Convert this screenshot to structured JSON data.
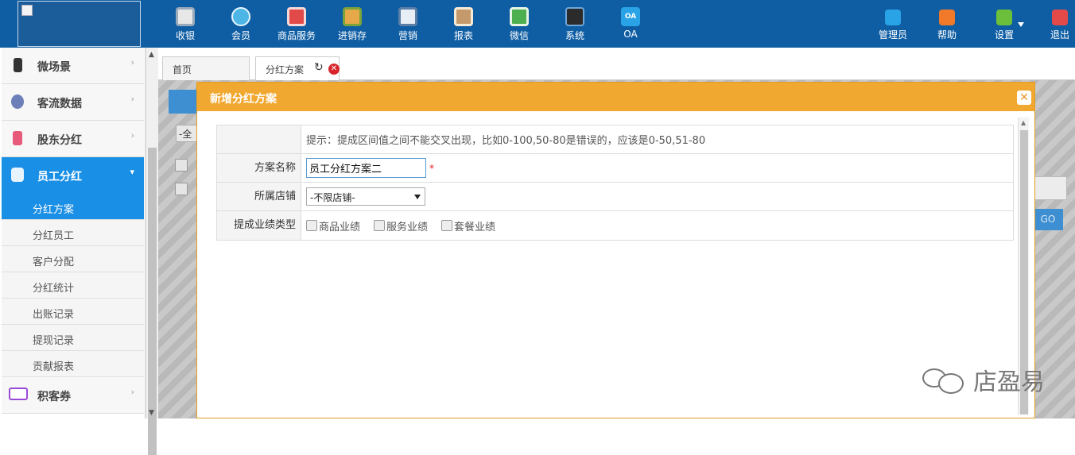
{
  "topnav": {
    "items": [
      {
        "label": "收银",
        "icon": "cash-register-icon",
        "color": "#e7e7e7"
      },
      {
        "label": "会员",
        "icon": "member-icon",
        "color": "#4db6e6"
      },
      {
        "label": "商品服务",
        "icon": "product-service-icon",
        "color": "#e24a4a"
      },
      {
        "label": "进销存",
        "icon": "inventory-icon",
        "color": "#e6a94a"
      },
      {
        "label": "营销",
        "icon": "megaphone-icon",
        "color": "#e8eef5"
      },
      {
        "label": "报表",
        "icon": "report-icon",
        "color": "#c49a6c"
      },
      {
        "label": "微信",
        "icon": "wechat-icon",
        "color": "#4caf50"
      },
      {
        "label": "系统",
        "icon": "monitor-icon",
        "color": "#2b2b2b"
      },
      {
        "label": "OA",
        "icon": "oa-icon",
        "color": "#29a3e6"
      }
    ],
    "right_items": [
      {
        "label": "管理员",
        "icon": "admin-icon",
        "color": "#29a3e6"
      },
      {
        "label": "帮助",
        "icon": "help-icon",
        "color": "#f07a2a"
      },
      {
        "label": "设置",
        "icon": "settings-gear-icon",
        "color": "#6cbf3a"
      },
      {
        "label": "退出",
        "icon": "logout-icon",
        "color": "#e24a4a"
      }
    ]
  },
  "sidebar": {
    "groups": [
      {
        "label": "微场景",
        "icon": "phone-icon",
        "color": "#333333"
      },
      {
        "label": "客流数据",
        "icon": "globe-icon",
        "color": "#6c7fb8"
      },
      {
        "label": "股东分红",
        "icon": "document-icon",
        "color": "#e85a7a"
      },
      {
        "label": "员工分红",
        "icon": "employee-icon",
        "color": "#ffffff"
      },
      {
        "label": "积客券",
        "icon": "coupon-icon",
        "color": "#9a4bd6"
      }
    ],
    "subitems": [
      "分红方案",
      "分红员工",
      "客户分配",
      "分红统计",
      "出账记录",
      "提现记录",
      "贡献报表"
    ]
  },
  "tabs": {
    "home": "首页",
    "current": "分红方案"
  },
  "background": {
    "select_text": "-全",
    "go_label": "GO"
  },
  "dialog": {
    "title": "新增分红方案",
    "hint": "提示：提成区间值之间不能交叉出现，比如0-100,50-80是错误的，应该是0-50,51-80",
    "fields": {
      "name_label": "方案名称",
      "name_value": "员工分红方案二",
      "required_mark": "*",
      "store_label": "所属店铺",
      "store_value": "-不限店铺-",
      "type_label": "提成业绩类型",
      "type_options": [
        "商品业绩",
        "服务业绩",
        "套餐业绩"
      ]
    }
  },
  "watermark": {
    "text": "店盈易"
  }
}
